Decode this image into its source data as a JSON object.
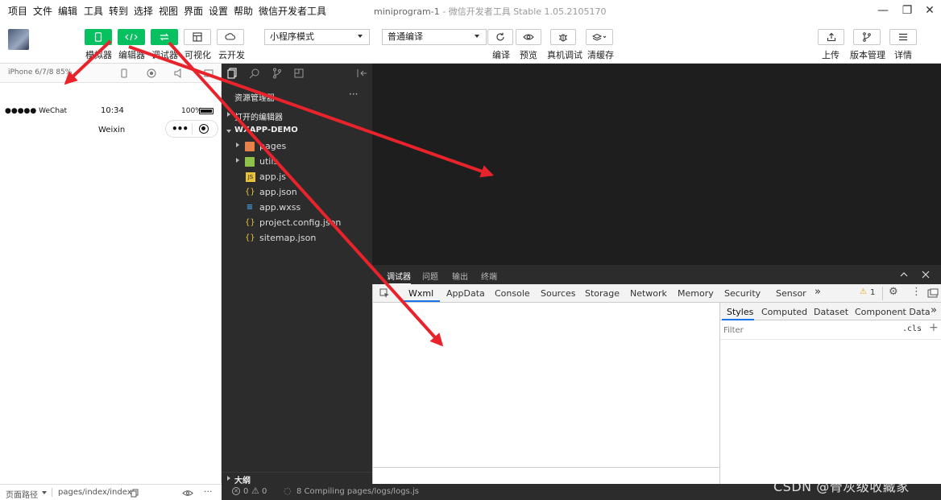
{
  "menu": [
    "项目",
    "文件",
    "编辑",
    "工具",
    "转到",
    "选择",
    "视图",
    "界面",
    "设置",
    "帮助",
    "微信开发者工具"
  ],
  "window": {
    "title": "miniprogram-1",
    "subtitle": " - 微信开发者工具 Stable 1.05.2105170"
  },
  "toolbar": {
    "simulator_label": "模拟器",
    "editor_label": "编辑器",
    "debugger_label": "调试器",
    "visual_label": "可视化",
    "cloud_label": "云开发",
    "mode_select": "小程序模式",
    "compile_select": "普通编译",
    "compile_label": "编译",
    "preview_label": "预览",
    "realdevice_label": "真机调试",
    "clearcache_label": "清缓存",
    "upload_label": "上传",
    "version_label": "版本管理",
    "detail_label": "详情"
  },
  "simulator": {
    "device": "iPhone 6/7/8 85%",
    "carrier": "●●●●● WeChat",
    "time": "10:34",
    "battery": "100%",
    "nav_title": "Weixin",
    "capsule_dots": "•••"
  },
  "explorer": {
    "header": "资源管理器",
    "more": "···",
    "open_editors": "打开的编辑器",
    "project": "WXAPP-DEMO",
    "files": [
      {
        "name": "pages",
        "type": "folder"
      },
      {
        "name": "utils",
        "type": "folder"
      },
      {
        "name": "app.js",
        "type": "js"
      },
      {
        "name": "app.json",
        "type": "json"
      },
      {
        "name": "app.wxss",
        "type": "wxss"
      },
      {
        "name": "project.config.json",
        "type": "json"
      },
      {
        "name": "sitemap.json",
        "type": "json"
      }
    ],
    "outline": "大纲"
  },
  "debugger": {
    "tabs": [
      "调试器",
      "问题",
      "输出",
      "终端"
    ],
    "devtools_tabs": [
      "Wxml",
      "AppData",
      "Console",
      "Sources",
      "Storage",
      "Network",
      "Memory",
      "Security",
      "Sensor"
    ],
    "more_tabs": "»",
    "warning_count": "1",
    "styles_tabs": [
      "Styles",
      "Computed",
      "Dataset",
      "Component Data"
    ],
    "filter_placeholder": "Filter",
    "cls": ".cls",
    "plus": "+"
  },
  "footer": {
    "page_path_label": "页面路径",
    "page_path": "pages/index/index",
    "errors": "0",
    "warnings": "0",
    "compiling": "8 Compiling pages/logs/logs.js"
  },
  "watermark": "CSDN @骨灰级收藏家",
  "colors": {
    "accent_green": "#07c160",
    "arrow_red": "#e8232b",
    "dark_panel": "#2c2c2c",
    "editor_bg": "#1e1e1e"
  }
}
